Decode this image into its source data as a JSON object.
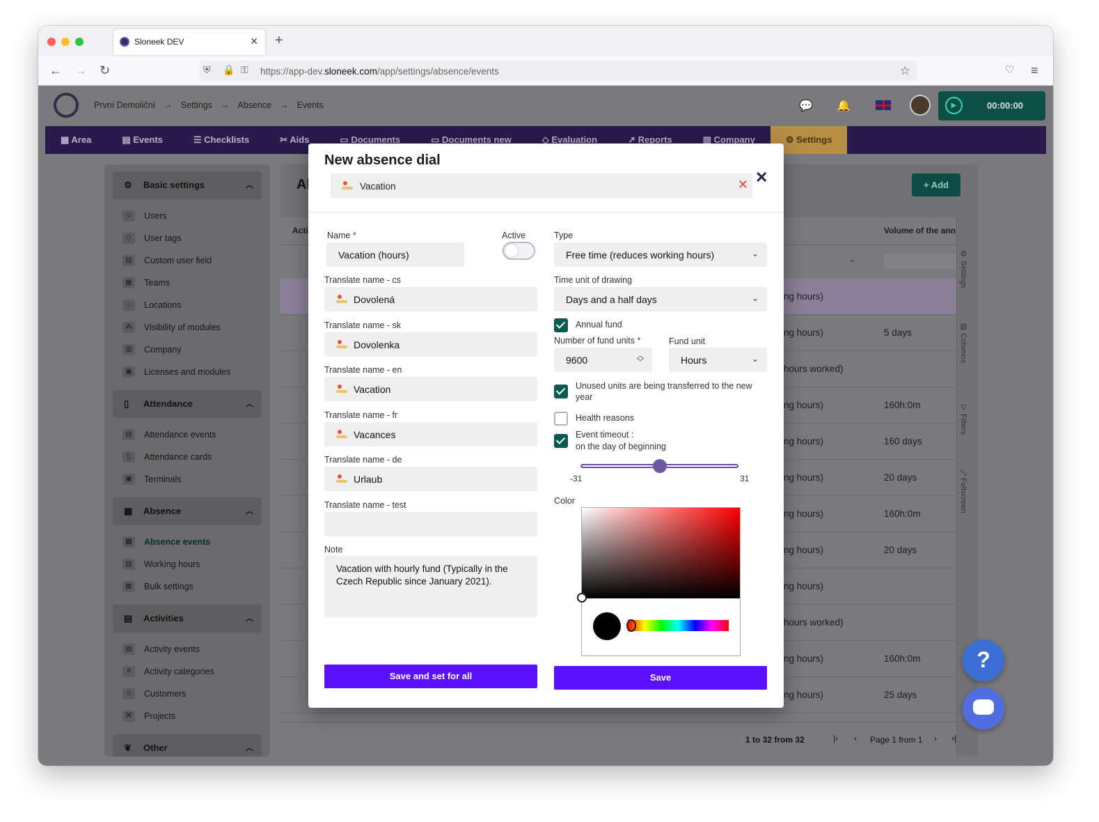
{
  "browser": {
    "tab_title": "Sloneek DEV",
    "url_prefix": "https://app-dev.",
    "url_domain": "sloneek.com",
    "url_path": "/app/settings/absence/events"
  },
  "header": {
    "breadcrumbs": [
      "První Demoliční",
      "→",
      "Settings",
      "→",
      "Absence",
      "→",
      "Events"
    ],
    "timer": "00:00:00"
  },
  "menu": [
    "Area",
    "Events",
    "Checklists",
    "Aids",
    "Documents",
    "Documents new",
    "Evaluation",
    "Reports",
    "Company",
    "Settings"
  ],
  "sidebar": {
    "sections": [
      {
        "title": "Basic settings",
        "items": [
          "Users",
          "User tags",
          "Custom user field",
          "Teams",
          "Locations",
          "Visibility of modules",
          "Company",
          "Licenses and modules"
        ]
      },
      {
        "title": "Attendance",
        "items": [
          "Attendance events",
          "Attendance cards",
          "Terminals"
        ]
      },
      {
        "title": "Absence",
        "items": [
          "Absence events",
          "Working hours",
          "Bulk settings"
        ]
      },
      {
        "title": "Activities",
        "items": [
          "Activity events",
          "Activity categories",
          "Customers",
          "Projects"
        ]
      },
      {
        "title": "Other",
        "items": []
      }
    ]
  },
  "main": {
    "title_fragment": "Al",
    "add_label": "Add",
    "col_left": "Acti",
    "col_right": "Volume of the ann",
    "rows": [
      {
        "a": "ng hours)",
        "b": ""
      },
      {
        "a": "ng hours)",
        "b": "5 days"
      },
      {
        "a": "hours worked)",
        "b": ""
      },
      {
        "a": "ng hours)",
        "b": "160h:0m"
      },
      {
        "a": "ng hours)",
        "b": "160 days"
      },
      {
        "a": "ng hours)",
        "b": "20 days"
      },
      {
        "a": "ng hours)",
        "b": "160h:0m"
      },
      {
        "a": "ng hours)",
        "b": "20 days"
      },
      {
        "a": "ng hours)",
        "b": ""
      },
      {
        "a": "hours worked)",
        "b": ""
      },
      {
        "a": "ng hours)",
        "b": "160h:0m"
      },
      {
        "a": "ng hours)",
        "b": "25 days"
      }
    ],
    "side_tabs": [
      "Settings",
      "Columns",
      "Filters",
      "Fullscreen"
    ],
    "pager": {
      "range": "1 to 32 from 32",
      "page": "Page 1 from 1"
    }
  },
  "modal": {
    "title": "New absence dial",
    "selected_event": "Vacation",
    "name_label": "Name",
    "name_value": "Vacation (hours)",
    "active_label": "Active",
    "translations": [
      {
        "label": "Translate name - cs",
        "value": "Dovolená"
      },
      {
        "label": "Translate name - sk",
        "value": "Dovolenka"
      },
      {
        "label": "Translate name - en",
        "value": "Vacation"
      },
      {
        "label": "Translate name - fr",
        "value": "Vacances"
      },
      {
        "label": "Translate name - de",
        "value": "Urlaub"
      },
      {
        "label": "Translate name - test",
        "value": ""
      }
    ],
    "note_label": "Note",
    "note_value": "Vacation with hourly fund (Typically in the Czech Republic since January 2021).",
    "type_label": "Type",
    "type_value": "Free time (reduces working hours)",
    "time_unit_label": "Time unit of drawing",
    "time_unit_value": "Days and a half days",
    "annual_fund_label": "Annual fund",
    "fund_units_label": "Number of fund units",
    "fund_units_value": "9600",
    "fund_unit_label": "Fund unit",
    "fund_unit_value": "Hours",
    "transfer_label": "Unused units are being transferred to the new year",
    "health_label": "Health reasons",
    "timeout_label": "Event timeout :",
    "timeout_sub": "on the day of beginning",
    "slider_min": "-31",
    "slider_max": "31",
    "slider_value": 0,
    "color_label": "Color",
    "color_value": "#000000",
    "save_all_label": "Save and set for all",
    "save_label": "Save"
  }
}
